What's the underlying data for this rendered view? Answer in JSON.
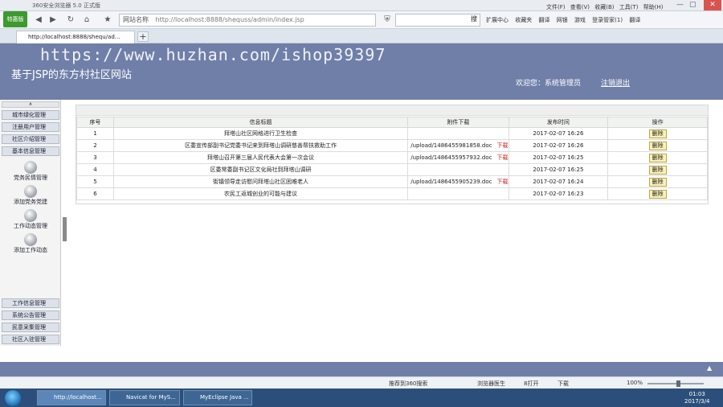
{
  "browser": {
    "title": "360安全浏览器 5.0 正式版",
    "badge": "特惠版",
    "address": "http://localhost:8888/shequss/admin/index.jsp",
    "address_prefix": "网站名称",
    "go_label": "搜",
    "tab_title": "http://localhost:8888/shequ/ad...",
    "menu": [
      "文件(F)",
      "查看(V)",
      "收藏(B)",
      "工具(T)",
      "帮助(H)"
    ],
    "toolbar": [
      "扩展中心",
      "收藏夹",
      "翻译",
      "网银",
      "游戏",
      "登录管家(1)",
      "翻译"
    ]
  },
  "header": {
    "watermark": "https://www.huzhan.com/ishop39397",
    "site_title": "基于JSP的东方村社区网站",
    "welcome": "欢迎您：系统管理员",
    "logout": "注销退出"
  },
  "sidebar": {
    "toggle": "∧",
    "top_items": [
      "城市绿化管理",
      "注册用户管理",
      "社区介绍管理",
      "基本信息管理"
    ],
    "sub_items": [
      "党务民情管理",
      "添加党务党建",
      "工作动态管理",
      "添加工作动态"
    ],
    "bottom_items": [
      "工作信息管理",
      "系统公告管理",
      "民意采集管理",
      "社区入驻管理"
    ]
  },
  "table": {
    "columns": [
      "序号",
      "信息标题",
      "附件下载",
      "发布时间",
      "操作"
    ],
    "download_label": "下载",
    "delete_label": "删除",
    "rows": [
      {
        "id": "1",
        "title": "拜塔山社区网格进行卫生检查",
        "attachment": "",
        "time": "2017-02-07 16:26"
      },
      {
        "id": "2",
        "title": "区委宣传部副书记党委书记来到拜塔山调研慈善帮扶救助工作",
        "attachment": "/upload/1486455981858.doc",
        "time": "2017-02-07 16:26"
      },
      {
        "id": "3",
        "title": "拜塔山召开第三届人民代表大会第一次会议",
        "attachment": "/upload/1486455957932.doc",
        "time": "2017-02-07 16:25"
      },
      {
        "id": "4",
        "title": "区委常委副书记区文化局社到拜塔山调研",
        "attachment": "",
        "time": "2017-02-07 16:25"
      },
      {
        "id": "5",
        "title": "街镇领导走访慰问拜塔山社区困难老人",
        "attachment": "/upload/1486455905239.doc",
        "time": "2017-02-07 16:24"
      },
      {
        "id": "6",
        "title": "农民工返城创业的可能与建议",
        "attachment": "",
        "time": "2017-02-07 16:23"
      }
    ]
  },
  "statusbar": {
    "items": [
      "推荐到360搜索",
      "浏览器医生",
      "8打开",
      "下载"
    ],
    "zoom": "100%"
  },
  "taskbar": {
    "buttons": [
      "http://localhost...",
      "Navicat for MyS...",
      "MyEclipse Java ..."
    ],
    "time": "01:03",
    "date": "2017/3/4"
  }
}
